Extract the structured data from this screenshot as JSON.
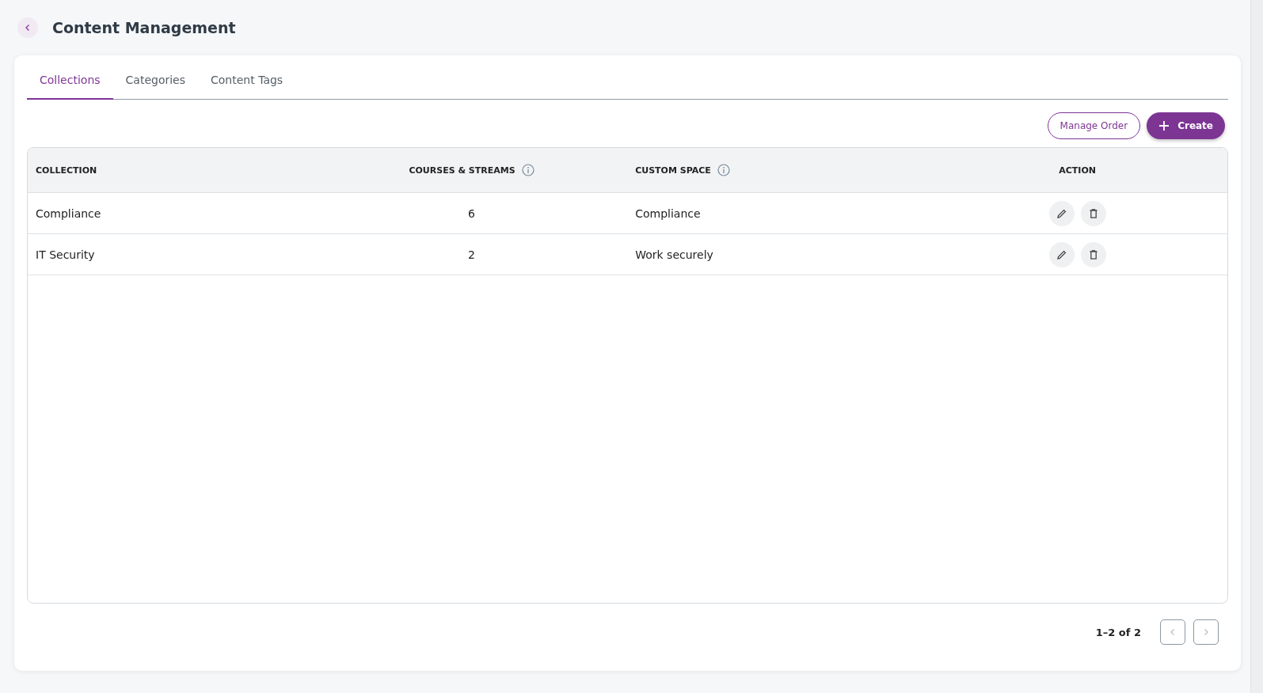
{
  "page": {
    "title": "Content Management"
  },
  "tabs": [
    {
      "label": "Collections",
      "selected": true
    },
    {
      "label": "Categories",
      "selected": false
    },
    {
      "label": "Content Tags",
      "selected": false
    }
  ],
  "toolbar": {
    "manage_order": "Manage Order",
    "create": "Create"
  },
  "table": {
    "columns": [
      {
        "label": "COLLECTION",
        "info": false
      },
      {
        "label": "COURSES & STREAMS",
        "info": true
      },
      {
        "label": "CUSTOM SPACE",
        "info": true
      },
      {
        "label": "ACTION",
        "info": false
      }
    ],
    "rows": [
      {
        "collection": "Compliance",
        "courses_streams": "6",
        "custom_space": "Compliance"
      },
      {
        "collection": "IT Security",
        "courses_streams": "2",
        "custom_space": "Work securely"
      }
    ]
  },
  "pagination": {
    "range": "1–2 of 2",
    "previous_disabled": true,
    "next_disabled": true
  }
}
